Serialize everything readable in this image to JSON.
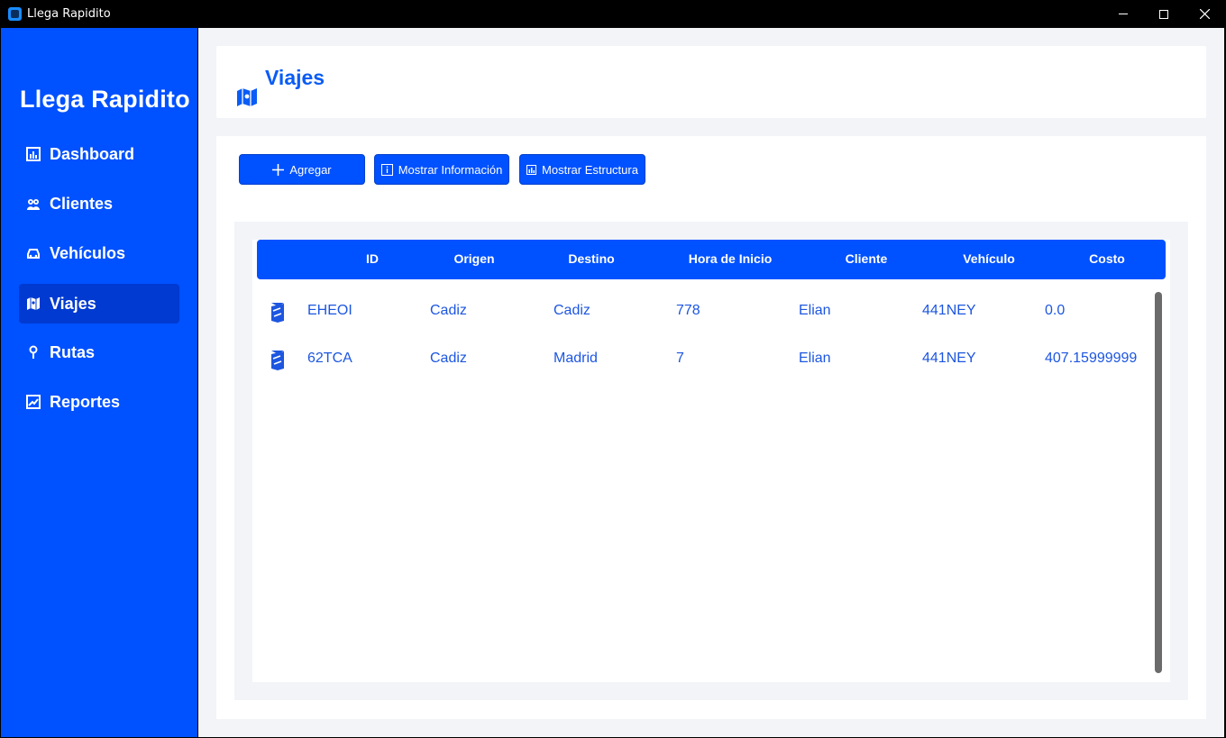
{
  "window": {
    "title": "Llega Rapidito"
  },
  "sidebar": {
    "brand": "Llega Rapidito",
    "items": [
      {
        "label": "Dashboard",
        "icon": "dashboard-icon",
        "active": false
      },
      {
        "label": "Clientes",
        "icon": "clients-icon",
        "active": false
      },
      {
        "label": "Vehículos",
        "icon": "car-icon",
        "active": false
      },
      {
        "label": "Viajes",
        "icon": "map-icon",
        "active": true
      },
      {
        "label": "Rutas",
        "icon": "pin-icon",
        "active": false
      },
      {
        "label": "Reportes",
        "icon": "report-icon",
        "active": false
      }
    ]
  },
  "header": {
    "title": "Viajes",
    "icon": "map-icon"
  },
  "toolbar": {
    "add_label": "Agregar",
    "info_label": "Mostrar Información",
    "structure_label": "Mostrar Estructura"
  },
  "table": {
    "columns": [
      "ID",
      "Origen",
      "Destino",
      "Hora de Inicio",
      "Cliente",
      "Vehículo",
      "Costo"
    ],
    "rows": [
      [
        "EHEOI",
        "Cadiz",
        "Cadiz",
        "778",
        "Elian",
        "441NEY",
        "0.0"
      ],
      [
        "62TCA",
        "Cadiz",
        "Madrid",
        "7",
        "Elian",
        "441NEY",
        "407.15999999"
      ]
    ]
  },
  "colors": {
    "accent": "#0051ff",
    "active_nav": "#003ad0",
    "title_text": "#0a5cf5",
    "row_text": "#1d56e0",
    "background": "#f2f4f8"
  }
}
